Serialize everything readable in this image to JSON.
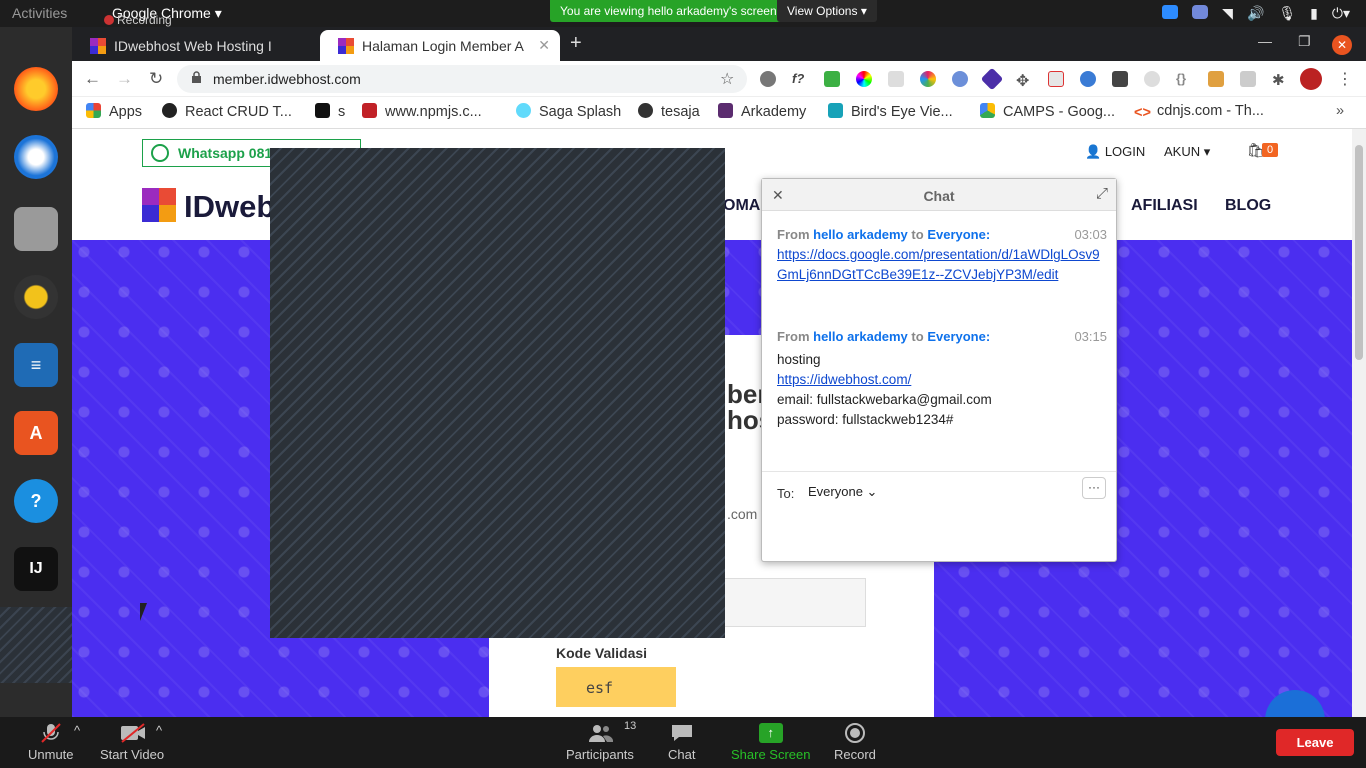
{
  "os": {
    "activities": "Activities",
    "app_menu": "Google Chrome",
    "recording": "Recording",
    "zoom_banner": "You are viewing hello arkademy's screen",
    "view_options": "View Options"
  },
  "browser": {
    "tabs": [
      {
        "title": "IDwebhost Web Hosting I",
        "active": false
      },
      {
        "title": "Halaman Login Member A",
        "active": true
      }
    ],
    "url": "member.idwebhost.com",
    "bookmarks": [
      "Apps",
      "React CRUD T...",
      "s",
      "www.npmjs.c...",
      "Saga Splash",
      "tesaja",
      "Arkademy",
      "Bird's Eye Vie...",
      "CAMPS - Goog...",
      "cdnjs.com - Th..."
    ]
  },
  "website": {
    "whatsapp": "Whatsapp 081",
    "login": "LOGIN",
    "akun": "AKUN",
    "cart_count": "0",
    "logo": "IDweb",
    "menu": [
      "OMAI",
      "AFILIASI",
      "BLOG"
    ],
    "card_heading_1": "ber",
    "card_heading_2": "hos",
    "email_fragment": ".com",
    "kode_validasi_label": "Kode Validasi",
    "captcha": "esf"
  },
  "chat": {
    "title": "Chat",
    "messages": [
      {
        "from": "hello arkademy",
        "to_word": "to",
        "to": "Everyone:",
        "time": "03:03",
        "link": "https://docs.google.com/presentation/d/1aWDlgLOsv9GmLj6nnDGtTCcBe39E1z--ZCVJebjYP3M/edit"
      },
      {
        "from": "hello arkademy",
        "to_word": "to",
        "to": "Everyone:",
        "time": "03:15",
        "line1": "hosting",
        "link": "https://idwebhost.com/",
        "line2": "email: fullstackwebarka@gmail.com",
        "line3": "password: fullstackweb1234#"
      }
    ],
    "to_label": "To:",
    "recipient": "Everyone",
    "more": "···"
  },
  "zoom_bar": {
    "unmute": "Unmute",
    "start_video": "Start Video",
    "participants": "Participants",
    "participants_count": "13",
    "chat": "Chat",
    "share_screen": "Share Screen",
    "record": "Record",
    "leave": "Leave"
  },
  "colors": {
    "hero_purple": "#4b2ef0",
    "zoom_green": "#27a327",
    "leave_red": "#e02828",
    "link_blue": "#0e48cf"
  }
}
